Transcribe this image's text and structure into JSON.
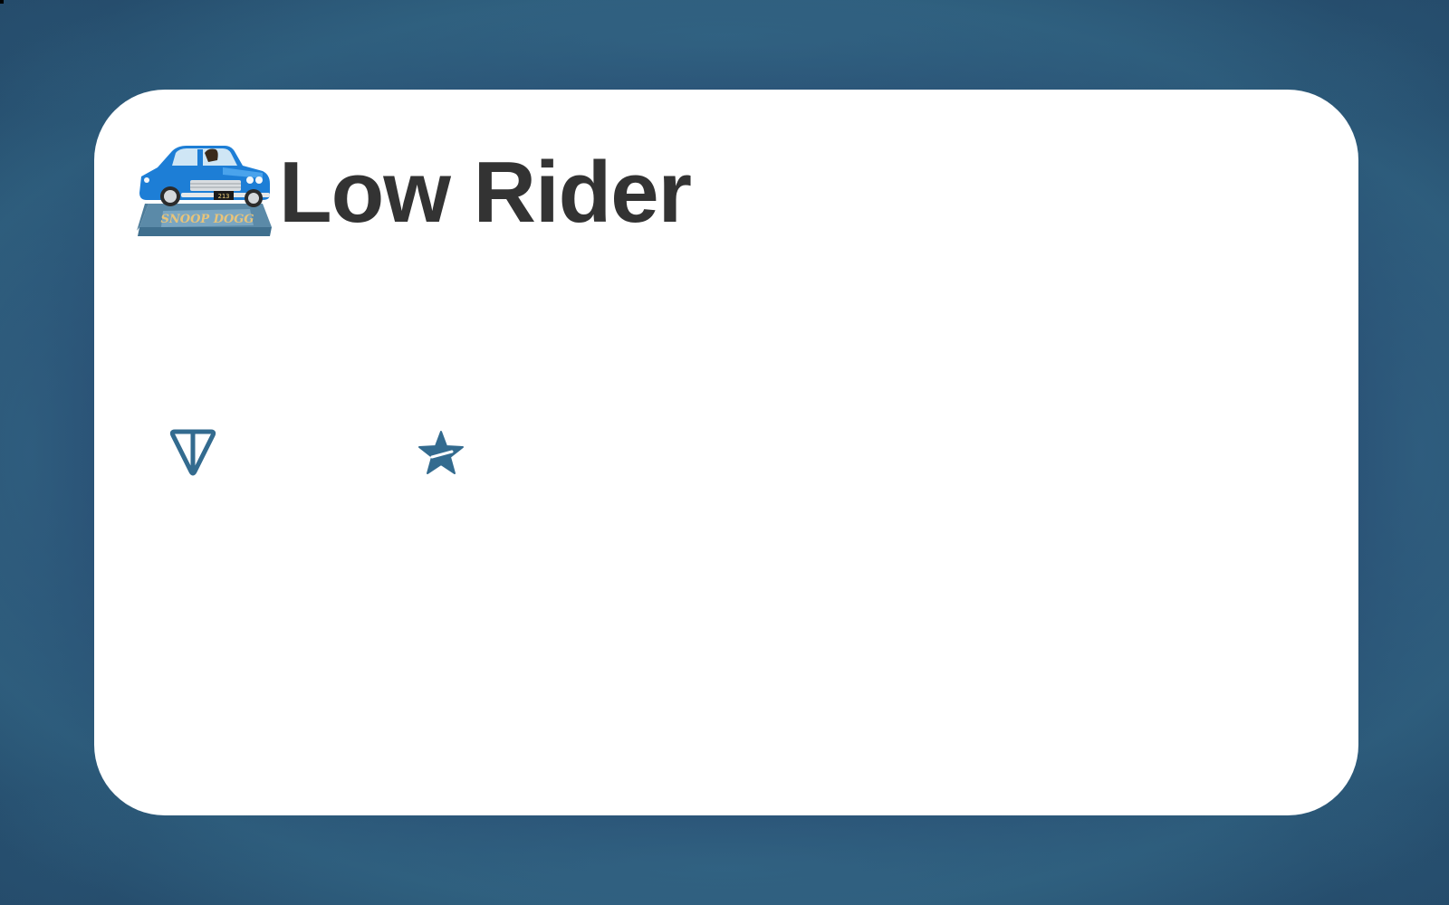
{
  "title": "Low Rider",
  "logo": {
    "name": "lowrider-car-logo",
    "plate_text": "213",
    "badge_text": "SNOOP DOGG"
  },
  "icons": [
    {
      "name": "ton-icon"
    },
    {
      "name": "star-icon"
    }
  ],
  "colors": {
    "background": "#285176",
    "card": "#ffffff",
    "title_text": "#333333",
    "icon": "#336b8f",
    "car_body": "#1d7ed6"
  }
}
